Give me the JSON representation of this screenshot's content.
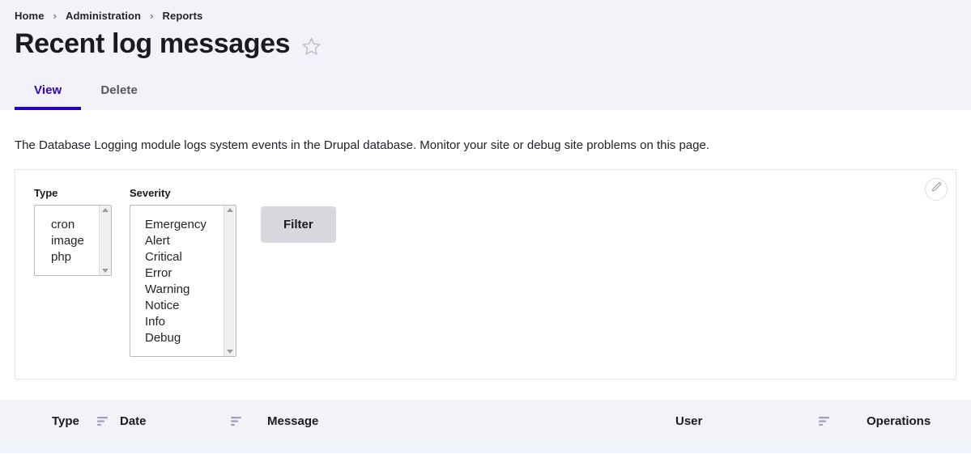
{
  "breadcrumb": {
    "separator": "›",
    "items": [
      {
        "label": "Home"
      },
      {
        "label": "Administration"
      },
      {
        "label": "Reports"
      }
    ]
  },
  "header": {
    "title": "Recent log messages",
    "star_icon": "star-outline-icon"
  },
  "tabs": [
    {
      "label": "View",
      "active": true
    },
    {
      "label": "Delete",
      "active": false
    }
  ],
  "main": {
    "intro": "The Database Logging module logs system events in the Drupal database. Monitor your site or debug site problems on this page."
  },
  "filter": {
    "contextual_icon": "pencil-icon",
    "type": {
      "label": "Type",
      "options": [
        "cron",
        "image",
        "php"
      ]
    },
    "severity": {
      "label": "Severity",
      "options": [
        "Emergency",
        "Alert",
        "Critical",
        "Error",
        "Warning",
        "Notice",
        "Info",
        "Debug"
      ]
    },
    "submit_label": "Filter"
  },
  "table": {
    "columns": [
      {
        "label": "Type",
        "sortable": true
      },
      {
        "label": "Date",
        "sortable": true
      },
      {
        "label": "Message",
        "sortable": false
      },
      {
        "label": "User",
        "sortable": true
      },
      {
        "label": "Operations",
        "sortable": false
      }
    ]
  },
  "colors": {
    "header_band": "#f3f2f8",
    "accent": "#2600c4",
    "active_tab_text": "#3000cc",
    "table_header": "#f3f2f7",
    "table_row": "#f2f5fd",
    "button": "#d8d7dd"
  }
}
